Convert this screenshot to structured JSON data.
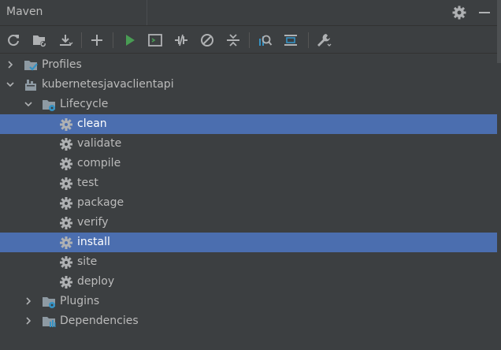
{
  "header": {
    "title": "Maven",
    "settings_icon": "gear-icon",
    "hide_icon": "minimize-icon"
  },
  "toolbar": {
    "buttons": [
      {
        "name": "reload-all-projects",
        "icon": "refresh-icon"
      },
      {
        "name": "generate-sources",
        "icon": "folder-refresh-icon"
      },
      {
        "name": "download-sources",
        "icon": "download-icon"
      },
      {
        "name": "add-maven-project",
        "icon": "plus-icon"
      },
      {
        "name": "run-maven-build",
        "icon": "run-icon"
      },
      {
        "name": "execute-maven-goal",
        "icon": "terminal-icon"
      },
      {
        "name": "toggle-offline-mode",
        "icon": "offline-icon"
      },
      {
        "name": "skip-tests",
        "icon": "skip-icon"
      },
      {
        "name": "collapse-all",
        "icon": "collapse-icon"
      },
      {
        "name": "analyze-dependencies",
        "icon": "analyze-icon"
      },
      {
        "name": "show-dependencies",
        "icon": "diagram-icon"
      },
      {
        "name": "build-tool-settings",
        "icon": "wrench-icon"
      }
    ],
    "colors": {
      "run": "#499c54",
      "analyze": "#3592c4"
    }
  },
  "tree": {
    "profiles": {
      "label": "Profiles",
      "expanded": false
    },
    "project": {
      "label": "kubernetesjavaclientapi",
      "expanded": true
    },
    "lifecycle": {
      "label": "Lifecycle",
      "expanded": true
    },
    "goals": [
      {
        "label": "clean",
        "selected": true
      },
      {
        "label": "validate",
        "selected": false
      },
      {
        "label": "compile",
        "selected": false
      },
      {
        "label": "test",
        "selected": false
      },
      {
        "label": "package",
        "selected": false
      },
      {
        "label": "verify",
        "selected": false
      },
      {
        "label": "install",
        "selected": true
      },
      {
        "label": "site",
        "selected": false
      },
      {
        "label": "deploy",
        "selected": false
      }
    ],
    "plugins": {
      "label": "Plugins",
      "expanded": false
    },
    "dependencies": {
      "label": "Dependencies",
      "expanded": false
    }
  },
  "colors": {
    "background": "#3c3f41",
    "selection": "#4b6eaf",
    "text": "#bbbbbb",
    "folder": "#8e9aa3",
    "accent_blue": "#3592c4"
  }
}
